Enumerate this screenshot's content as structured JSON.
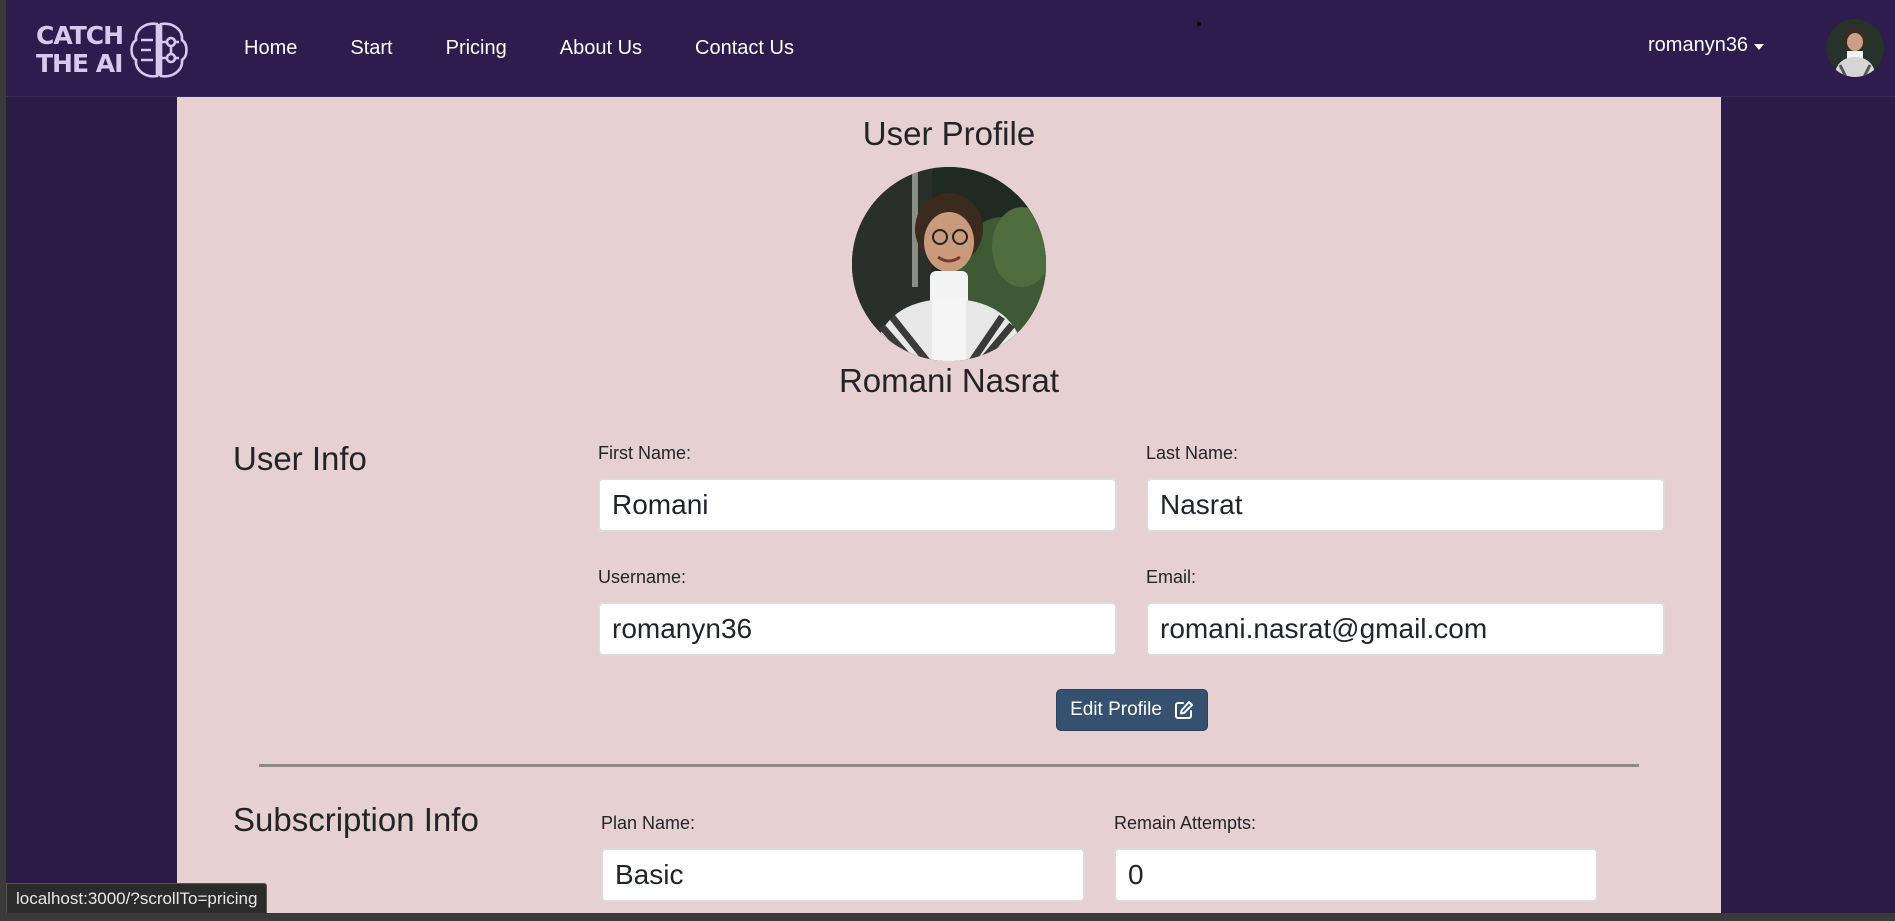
{
  "navbar": {
    "logo_line1": "CATCH",
    "logo_line2": "THE AI",
    "links": [
      "Home",
      "Start",
      "Pricing",
      "About Us",
      "Contact Us"
    ],
    "username": "romanyn36"
  },
  "profile": {
    "page_title": "User Profile",
    "full_name": "Romani Nasrat",
    "user_info_title": "User Info",
    "first_name_label": "First Name:",
    "first_name": "Romani",
    "last_name_label": "Last Name:",
    "last_name": "Nasrat",
    "username_label": "Username:",
    "username": "romanyn36",
    "email_label": "Email:",
    "email": "romani.nasrat@gmail.com",
    "edit_button": "Edit Profile",
    "edit_icon": "pencil-square-icon"
  },
  "subscription": {
    "title": "Subscription Info",
    "plan_label": "Plan Name:",
    "plan": "Basic",
    "attempts_label": "Remain Attempts:",
    "attempts": "0"
  },
  "status_bar": {
    "url": "localhost:3000/?scrollTo=pricing"
  },
  "colors": {
    "navbar_bg": "#2d1c4d",
    "page_bg": "#2b1b47",
    "card_bg": "#e6d0d1",
    "button_bg": "#36506f"
  }
}
